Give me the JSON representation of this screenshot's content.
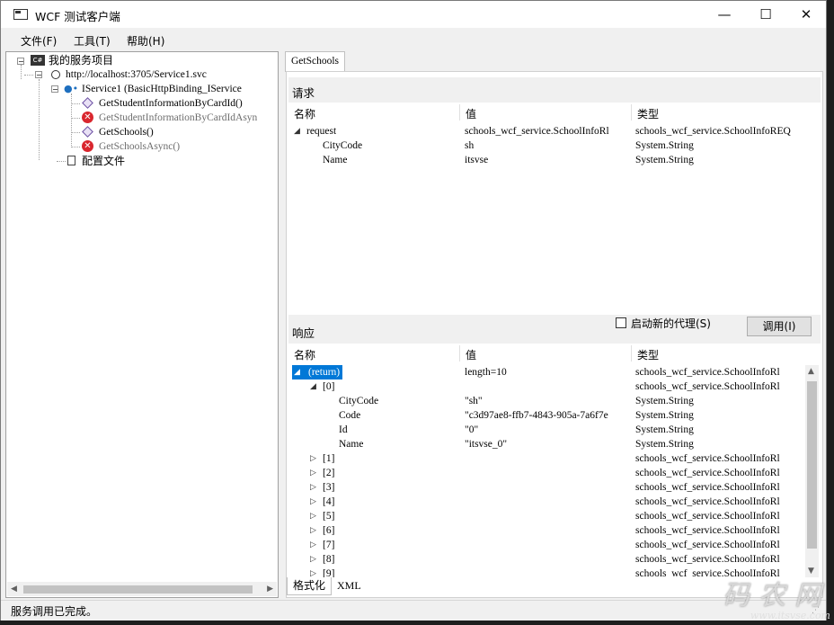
{
  "window": {
    "title": "WCF 测试客户端"
  },
  "menu": {
    "items": [
      "文件(F)",
      "工具(T)",
      "帮助(H)"
    ]
  },
  "tree": {
    "root": "我的服务项目",
    "endpoint": "http://localhost:3705/Service1.svc",
    "contract": "IService1 (BasicHttpBinding_IService",
    "operations": [
      {
        "label": "GetStudentInformationByCardId()",
        "status": "ok"
      },
      {
        "label": "GetStudentInformationByCardIdAsyn",
        "status": "error"
      },
      {
        "label": "GetSchools()",
        "status": "ok"
      },
      {
        "label": "GetSchoolsAsync()",
        "status": "error"
      }
    ],
    "config": "配置文件"
  },
  "tab": {
    "label": "GetSchools"
  },
  "request": {
    "header": "请求",
    "columns": [
      "名称",
      "值",
      "类型"
    ],
    "rows": [
      {
        "name": "request",
        "value": "schools_wcf_service.SchoolInfoRl",
        "type": "schools_wcf_service.SchoolInfoREQ",
        "level": 0,
        "expander": "expanded"
      },
      {
        "name": "CityCode",
        "value": "sh",
        "type": "System.String",
        "level": 1,
        "expander": ""
      },
      {
        "name": "Name",
        "value": "itsvse",
        "type": "System.String",
        "level": 1,
        "expander": ""
      }
    ]
  },
  "response": {
    "header": "响应",
    "new_proxy_label": "启动新的代理(S)",
    "new_proxy_checked": false,
    "invoke_label": "调用(I)",
    "columns": [
      "名称",
      "值",
      "类型"
    ],
    "rows": [
      {
        "name": "(return)",
        "value": "length=10",
        "type": "schools_wcf_service.SchoolInfoRl",
        "level": 0,
        "expander": "expanded",
        "selected": true
      },
      {
        "name": "[0]",
        "value": "",
        "type": "schools_wcf_service.SchoolInfoRl",
        "level": 1,
        "expander": "expanded"
      },
      {
        "name": "CityCode",
        "value": "\"sh\"",
        "type": "System.String",
        "level": 2,
        "expander": ""
      },
      {
        "name": "Code",
        "value": "\"c3d97ae8-ffb7-4843-905a-7a6f7e",
        "type": "System.String",
        "level": 2,
        "expander": ""
      },
      {
        "name": "Id",
        "value": "\"0\"",
        "type": "System.String",
        "level": 2,
        "expander": ""
      },
      {
        "name": "Name",
        "value": "\"itsvse_0\"",
        "type": "System.String",
        "level": 2,
        "expander": ""
      },
      {
        "name": "[1]",
        "value": "",
        "type": "schools_wcf_service.SchoolInfoRl",
        "level": 1,
        "expander": "collapsed"
      },
      {
        "name": "[2]",
        "value": "",
        "type": "schools_wcf_service.SchoolInfoRl",
        "level": 1,
        "expander": "collapsed"
      },
      {
        "name": "[3]",
        "value": "",
        "type": "schools_wcf_service.SchoolInfoRl",
        "level": 1,
        "expander": "collapsed"
      },
      {
        "name": "[4]",
        "value": "",
        "type": "schools_wcf_service.SchoolInfoRl",
        "level": 1,
        "expander": "collapsed"
      },
      {
        "name": "[5]",
        "value": "",
        "type": "schools_wcf_service.SchoolInfoRl",
        "level": 1,
        "expander": "collapsed"
      },
      {
        "name": "[6]",
        "value": "",
        "type": "schools_wcf_service.SchoolInfoRl",
        "level": 1,
        "expander": "collapsed"
      },
      {
        "name": "[7]",
        "value": "",
        "type": "schools_wcf_service.SchoolInfoRl",
        "level": 1,
        "expander": "collapsed"
      },
      {
        "name": "[8]",
        "value": "",
        "type": "schools_wcf_service.SchoolInfoRl",
        "level": 1,
        "expander": "collapsed"
      },
      {
        "name": "[9]",
        "value": "",
        "type": "schools_wcf_service.SchoolInfoRl",
        "level": 1,
        "expander": "collapsed"
      }
    ]
  },
  "bottom_tabs": [
    "格式化",
    "XML"
  ],
  "status": {
    "text": "服务调用已完成。"
  },
  "watermark": {
    "big": "码农网",
    "small": "www.itsvse.com"
  },
  "colors": {
    "selection": "#0078d7",
    "error": "#d9262e"
  }
}
